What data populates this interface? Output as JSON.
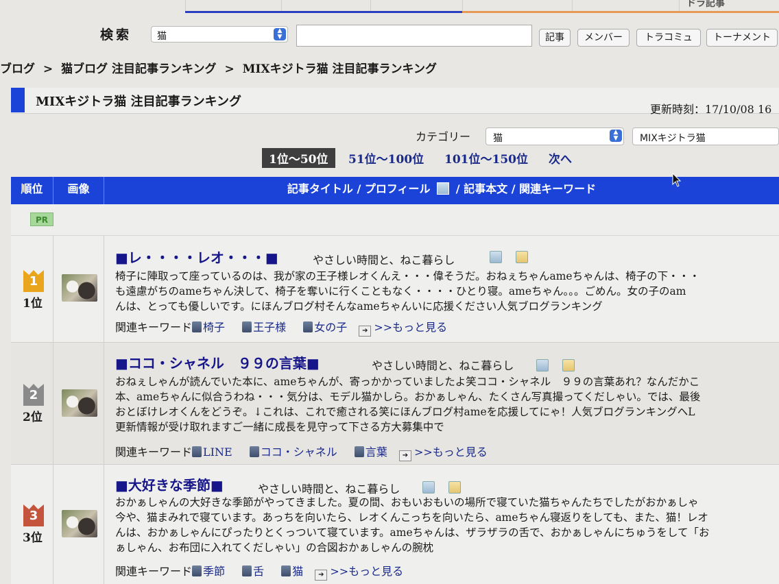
{
  "top_tabs": [
    "",
    "",
    "",
    "",
    "",
    "ドラ記事"
  ],
  "search": {
    "label": "検索",
    "select_value": "猫",
    "input_value": "",
    "buttons": [
      "記事",
      "メンバー",
      "トラコミュ",
      "トーナメント"
    ]
  },
  "breadcrumb": [
    "ブログ",
    ">",
    "猫ブログ 注目記事ランキング",
    ">",
    "MIXキジトラ猫 注目記事ランキング"
  ],
  "section": {
    "title": "MIXキジトラ猫 注目記事ランキング",
    "updated": "更新時刻：17/10/08 16"
  },
  "category": {
    "label": "カテゴリー",
    "primary": "猫",
    "secondary": "MIXキジトラ猫"
  },
  "pager": {
    "current": "1位〜50位",
    "items": [
      "51位〜100位",
      "101位〜150位",
      "次へ"
    ]
  },
  "table": {
    "headers": [
      "順位",
      "画像",
      "記事タイトル / プロフィール",
      "/ 記事本文 / 関連キーワード"
    ],
    "pr_label": "PR"
  },
  "colors": {
    "accent": "#1b43d8",
    "gold": "#e9a51c",
    "silver": "#8a8a8a",
    "bronze": "#c4553c"
  },
  "rows": [
    {
      "medal": "1",
      "rank": "1位",
      "title": "■レ・・・・レオ・・・■",
      "blog": "やさしい時間と、ねこ暮らし",
      "excerpt": [
        "椅子に陣取って座っているのは、我が家の王子様レオくんえ・・・偉そうだ。おねぇちゃんameちゃんは、椅子の下・・・",
        "も遠慮がちのameちゃん決して、椅子を奪いに行くこともなく・・・・ひとり寝。ameちゃん。。。ごめん。女の子のam",
        "んは、とっても優しいです。にほんブログ村そんなameちゃんいに応援ください人気ブログランキング"
      ],
      "kw_label": "関連キーワード",
      "keywords": [
        "椅子",
        "王子様",
        "女の子"
      ],
      "more": ">>もっと見る"
    },
    {
      "medal": "2",
      "rank": "2位",
      "title": "■ココ・シャネル　９９の言葉■",
      "blog": "やさしい時間と、ねこ暮らし",
      "excerpt": [
        "おねぇしゃんが読んでいた本に、ameちゃんが、寄っかかっていましたよ笑ココ・シャネル　９９の言葉あれ？なんだかこ",
        "本、ameちゃんに似合うわね・・・気分は、モデル猫かしら。おかぁしゃん、たくさん写真撮ってくだしゃい。では、最後",
        "おとぼけレオくんをどうぞ。↓これは、これで癒される笑にほんブログ村ameを応援してにゃ！人気ブログランキングへL",
        "更新情報が受け取れますご一緒に成長を見守って下さる方大募集中で"
      ],
      "kw_label": "関連キーワード",
      "keywords": [
        "LINE",
        "ココ・シャネル",
        "言葉"
      ],
      "more": ">>もっと見る"
    },
    {
      "medal": "3",
      "rank": "3位",
      "title": "■大好きな季節■",
      "blog": "やさしい時間と、ねこ暮らし",
      "excerpt": [
        "おかぁしゃんの大好きな季節がやってきました。夏の間、おもいおもいの場所で寝ていた猫ちゃんたちでしたがおかぁしゃ",
        "今や、猫まみれで寝ています。あっちを向いたら、レオくんこっちを向いたら、ameちゃん寝返りをしても、また、猫！レオ",
        "んは、おかぁしゃんにぴったりとくっついて寝ています。ameちゃんは、ザラザラの舌で、おかぁしゃんにちゅうをして「お",
        "ぁしゃん、お布団に入れてくだしゃい」の合図おかぁしゃんの腕枕"
      ],
      "kw_label": "関連キーワード",
      "keywords": [
        "季節",
        "舌",
        "猫"
      ],
      "more": ">>もっと見る"
    }
  ]
}
